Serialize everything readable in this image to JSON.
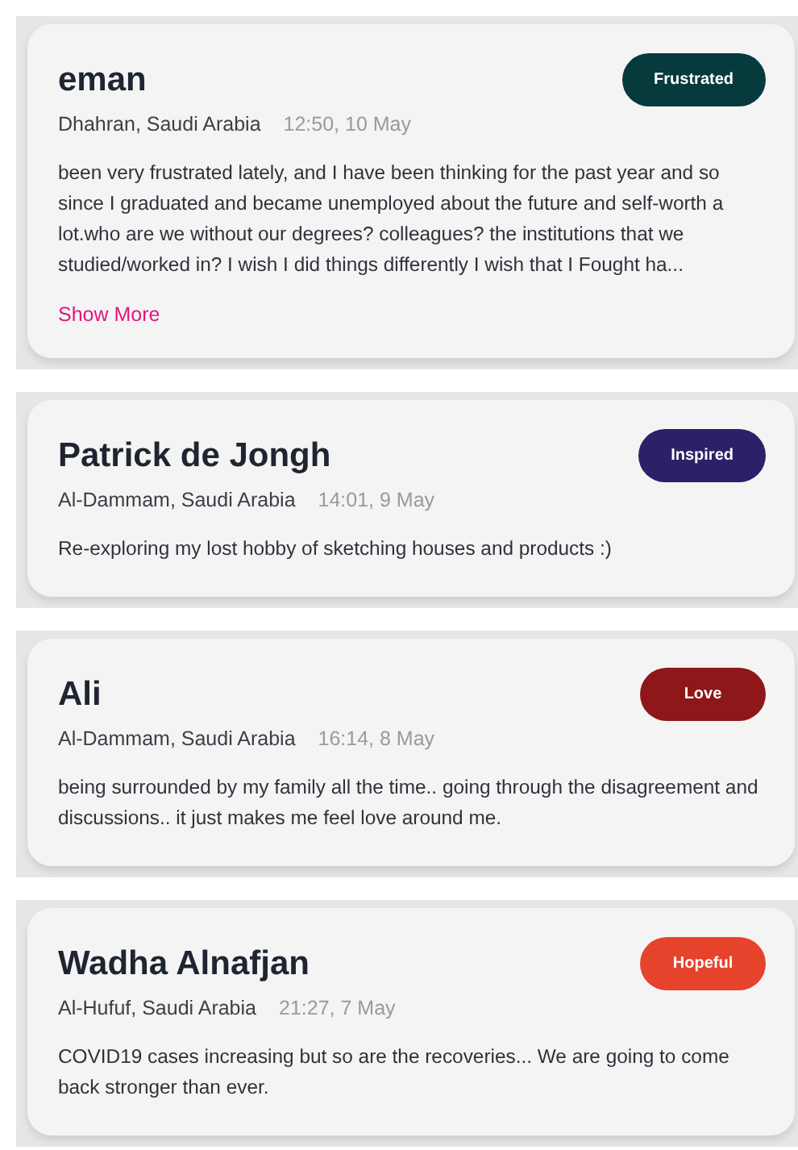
{
  "posts": [
    {
      "name": "eman",
      "mood": "Frustrated",
      "color": "#063a3d",
      "location": "Dhahran, Saudi Arabia",
      "time": "12:50, 10 May",
      "text": "been very frustrated lately, and I have been thinking for the past year and so since I graduated and became unemployed about the future and self-worth a lot.who are we without our degrees? colleagues? the institutions that we studied/worked in? I wish I did things differently I wish that I Fought ha...",
      "link": "Show More"
    },
    {
      "name": "Patrick de Jongh",
      "mood": "Inspired",
      "color": "#2b2168",
      "location": "Al-Dammam, Saudi Arabia",
      "time": "14:01, 9 May",
      "text": "Re-exploring my lost hobby of sketching houses and products :)"
    },
    {
      "name": "Ali",
      "mood": "Love",
      "color": "#8d1719",
      "location": "Al-Dammam, Saudi Arabia",
      "time": "16:14, 8 May",
      "text": "being surrounded by my family all the time.. going through the disagreement and discussions.. it just makes me feel love around me."
    },
    {
      "name": "Wadha Alnafjan",
      "mood": "Hopeful",
      "color": "#e5432b",
      "location": "Al-Hufuf, Saudi Arabia",
      "time": "21:27, 7 May",
      "text": "COVID19 cases increasing but so are the recoveries... We are going to come back stronger than ever."
    }
  ]
}
